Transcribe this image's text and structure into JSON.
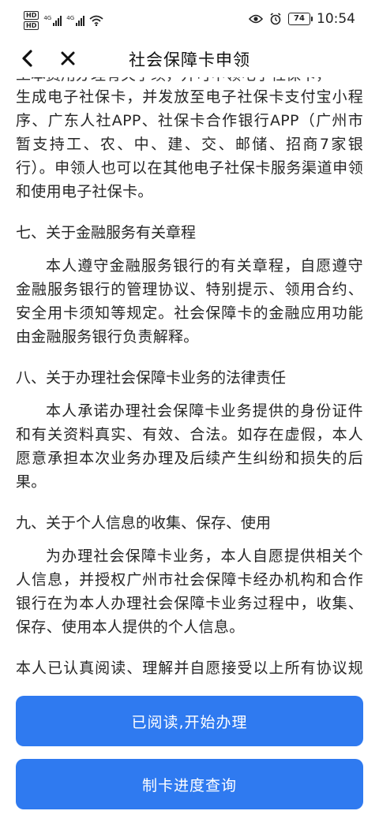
{
  "status_bar": {
    "badge_top": "HD",
    "badge_bottom": "HD",
    "signal1_tag": "4G",
    "signal2_tag": "4G",
    "battery": "74",
    "time": "10:54"
  },
  "nav": {
    "title": "社会保障卡申领"
  },
  "content": {
    "cut_line": "工本费用办理有关手续，并可申领电子社保卡，",
    "intro_paragraph": "生成电子社保卡，并发放至电子社保卡支付宝小程序、广东人社APP、社保卡合作银行APP（广州市暂支持工、农、中、建、交、邮储、招商7家银行）。申领人也可以在其他电子社保卡服务渠道申领和使用电子社保卡。",
    "sections": [
      {
        "heading": "七、关于金融服务有关章程",
        "body": "本人遵守金融服务银行的有关章程，自愿遵守金融服务银行的管理协议、特别提示、领用合约、安全用卡须知等规定。社会保障卡的金融应用功能由金融服务银行负责解释。"
      },
      {
        "heading": "八、关于办理社会保障卡业务的法律责任",
        "body": "本人承诺办理社会保障卡业务提供的身份证件和有关资料真实、有效、合法。如存在虚假，本人愿意承担本次业务办理及后续产生纠纷和损失的后果。"
      },
      {
        "heading": "九、关于个人信息的收集、保存、使用",
        "body": "为办理社会保障卡业务，本人自愿提供相关个人信息，并授权广州市社会保障卡经办机构和合作银行在为本人办理社会保障卡业务过程中，收集、保存、使用本人提供的个人信息。"
      }
    ],
    "final_statement": "本人已认真阅读、理解并自愿接受以上所有协议规定。"
  },
  "buttons": {
    "start_label": "已阅读,开始办理",
    "query_label": "制卡进度查询"
  },
  "colors": {
    "primary_button": "#2f7af0",
    "text": "#262626"
  }
}
